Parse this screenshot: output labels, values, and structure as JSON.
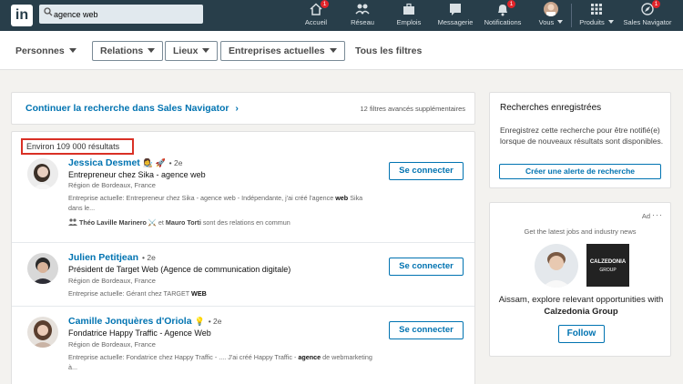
{
  "nav": {
    "logo": "in",
    "search": {
      "value": "agence web",
      "placeholder": "Rechercher"
    },
    "items": [
      {
        "label": "Accueil",
        "icon": "home-icon",
        "badge": "1"
      },
      {
        "label": "Réseau",
        "icon": "network-icon",
        "badge": ""
      },
      {
        "label": "Emplois",
        "icon": "briefcase-icon",
        "badge": ""
      },
      {
        "label": "Messagerie",
        "icon": "messaging-icon",
        "badge": ""
      },
      {
        "label": "Notifications",
        "icon": "bell-icon",
        "badge": "1"
      },
      {
        "label": "Vous",
        "icon": "avatar",
        "badge": ""
      },
      {
        "label": "Produits",
        "icon": "grid-icon",
        "badge": ""
      },
      {
        "label": "Sales Navigator",
        "icon": "compass-icon",
        "badge": "1"
      }
    ]
  },
  "filters": {
    "personnes": "Personnes",
    "relations": "Relations",
    "lieux": "Lieux",
    "entreprises": "Entreprises actuelles",
    "tous": "Tous les filtres"
  },
  "sales_nav": {
    "link": "Continuer la recherche dans Sales Navigator",
    "chevron": "›",
    "extra": "12 filtres avancés supplémentaires"
  },
  "results": {
    "count": "Environ 109 000 résultats",
    "people": [
      {
        "name": "Jessica Desmet",
        "emoji": "👩‍🎨 🚀",
        "degree": "• 2e",
        "title": "Entrepreneur chez Sika - agence web",
        "location": "Région de Bordeaux, France",
        "current_prefix": "Entreprise actuelle: Entrepreneur chez Sika - agence web - Indépendante, j'ai créé l'agence ",
        "current_bold": "web",
        "current_suffix": " Sika dans le...",
        "shared_a": "Théo Laville Marinero",
        "shared_sep": " ⚔️  et ",
        "shared_b": "Mauro Torti",
        "shared_tail": " sont des relations en commun",
        "connect": "Se connecter"
      },
      {
        "name": "Julien Petitjean",
        "emoji": "",
        "degree": "• 2e",
        "title": "Président de Target Web (Agence de communication digitale)",
        "location": "Région de Bordeaux, France",
        "current_prefix": "Entreprise actuelle: Gérant chez TARGET ",
        "current_bold": "WEB",
        "current_suffix": "",
        "connect": "Se connecter"
      },
      {
        "name": "Camille Jonquères d'Oriola",
        "emoji": "💡",
        "degree": "• 2e",
        "title": "Fondatrice Happy Traffic - Agence Web",
        "location": "Région de Bordeaux, France",
        "current_prefix": "Entreprise actuelle: Fondatrice chez Happy Traffic - .... J'ai créé Happy Traffic - ",
        "current_bold": "agence",
        "current_suffix": " de webmarketing à...",
        "connect": "Se connecter"
      }
    ]
  },
  "saved_searches": {
    "title": "Recherches enregistrées",
    "text": "Enregistrez cette recherche pour être notifié(e) lorsque de nouveaux résultats sont disponibles.",
    "button": "Créer une alerte de recherche"
  },
  "ad": {
    "label": "Ad",
    "more": "···",
    "tagline": "Get the latest jobs and industry news",
    "brand_line1": "CALZEDONIA",
    "brand_line2": "GROUP",
    "text_prefix": "Aissam, explore relevant opportunities with ",
    "text_bold": "Calzedonia Group",
    "follow": "Follow"
  },
  "colors": {
    "nav_bg": "#283e4a",
    "link": "#0073b1",
    "highlight_box": "#d93025",
    "badge": "#e2242a"
  }
}
